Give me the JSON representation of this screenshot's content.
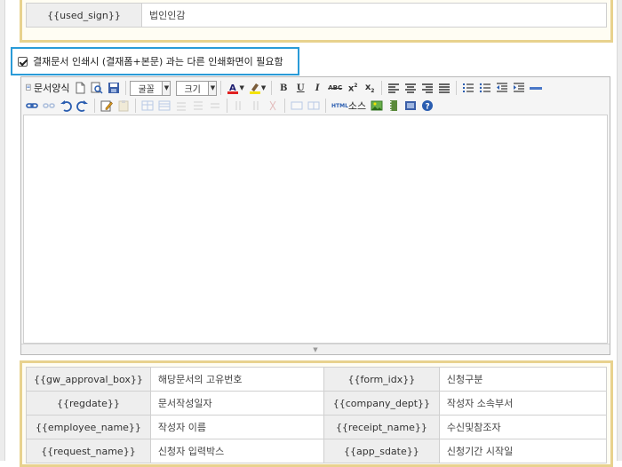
{
  "top_table": {
    "rows": [
      {
        "key": "{{used_sign}}",
        "value": "법인인감"
      }
    ]
  },
  "print_option": {
    "checked": true,
    "label": "결재문서 인쇄시 (결재폼+본문) 과는 다른 인쇄화면이 필요함"
  },
  "editor": {
    "toolbar": {
      "template_label": "문서양식",
      "font_select": "굴꼴",
      "size_select": "크기",
      "source_label": "소스",
      "html_label": "HTML"
    }
  },
  "bottom_table": {
    "rows": [
      {
        "k1": "{{gw_approval_box}}",
        "v1": "해당문서의 고유번호",
        "k2": "{{form_idx}}",
        "v2": "신청구분"
      },
      {
        "k1": "{{regdate}}",
        "v1": "문서작성일자",
        "k2": "{{company_dept}}",
        "v2": "작성자 소속부서"
      },
      {
        "k1": "{{employee_name}}",
        "v1": "작성자 이름",
        "k2": "{{receipt_name}}",
        "v2": "수신및참조자"
      },
      {
        "k1": "{{request_name}}",
        "v1": "신청자 입력박스",
        "k2": "{{app_sdate}}",
        "v2": "신청기간 시작일"
      }
    ]
  },
  "colors": {
    "highlight_border": "#2a9bd8",
    "gold_border": "#e8d28e",
    "font_color_accent": "#e02020",
    "bg_color_accent": "#f4e300"
  },
  "icons": [
    "new-doc-icon",
    "preview-icon",
    "save-icon",
    "bold-icon",
    "underline-icon",
    "italic-icon",
    "strike-icon",
    "superscript-icon",
    "subscript-icon",
    "align-left-icon",
    "align-center-icon",
    "align-right-icon",
    "align-justify-icon",
    "ordered-list-icon",
    "unordered-list-icon",
    "outdent-icon",
    "indent-icon",
    "hr-icon",
    "link-icon",
    "unlink-icon",
    "undo-icon",
    "redo-icon",
    "edit-icon",
    "paste-icon",
    "table-icon",
    "image-icon",
    "video-icon",
    "help-icon"
  ]
}
